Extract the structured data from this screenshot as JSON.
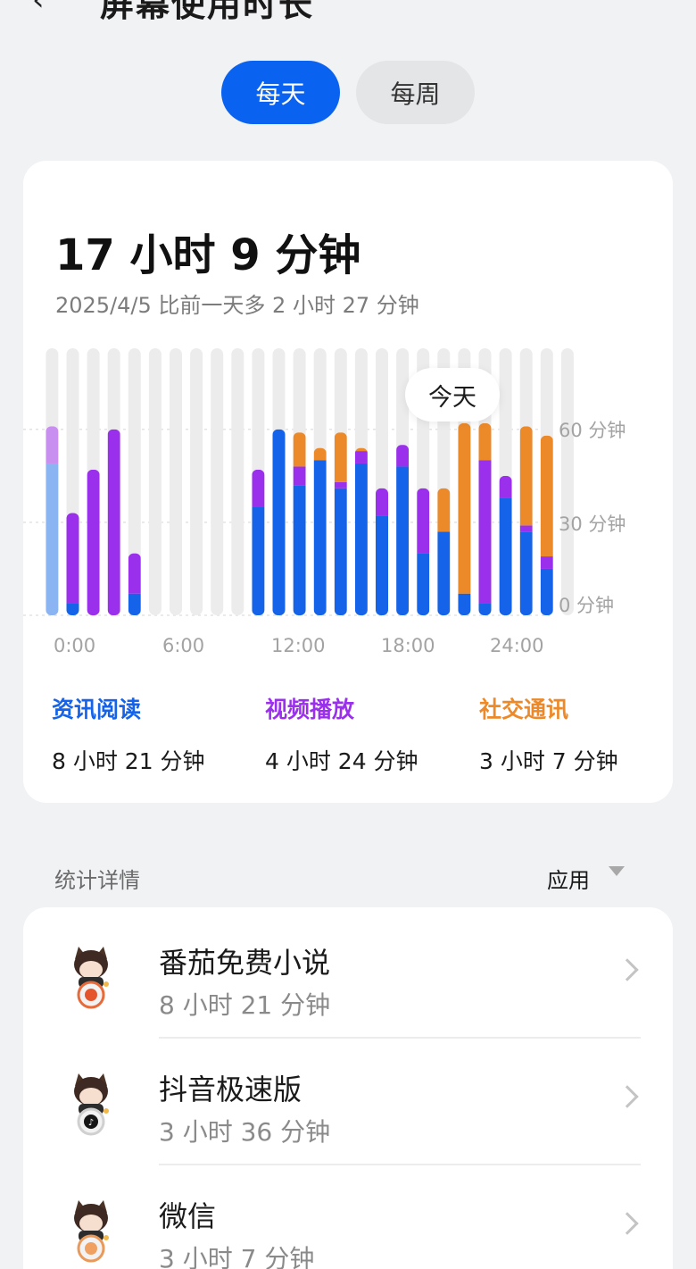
{
  "header": {
    "title": "屏幕使用时长",
    "back_icon": "back-arrow-icon"
  },
  "segments": {
    "day": "每天",
    "week": "每周",
    "selected": "day"
  },
  "summary": {
    "total": "17 小时 9 分钟",
    "compare": "2025/4/5 比前一天多 2 小时 27 分钟",
    "tooltip": "今天"
  },
  "colors": {
    "news": "#1463e8",
    "news_light": "#8ab4f2",
    "video": "#9b30ec",
    "video_light": "#c98ff0",
    "social": "#ec8a2a",
    "track": "#ececec",
    "accent": "#0a62f0"
  },
  "chart_data": {
    "type": "bar",
    "stacked": true,
    "y_tick_labels": [
      "60 分钟",
      "30 分钟",
      "0 分钟"
    ],
    "y_ticks": [
      60,
      30,
      0
    ],
    "ylim": [
      0,
      60
    ],
    "x_tick_labels": [
      "0:00",
      "6:00",
      "12:00",
      "18:00",
      "24:00"
    ],
    "x_ticks": [
      0,
      6,
      12,
      18,
      24
    ],
    "bar_start_hours": [
      -1,
      0,
      1,
      2,
      3,
      4,
      5,
      6,
      7,
      8,
      9,
      10,
      11,
      12,
      13,
      14,
      15,
      16,
      17,
      18,
      19,
      20,
      21,
      22,
      23,
      24
    ],
    "series": [
      {
        "name": "资讯阅读",
        "color": "#1463e8",
        "values": [
          49,
          4,
          0,
          0,
          7,
          0,
          0,
          0,
          0,
          0,
          35,
          60,
          42,
          50,
          41,
          49,
          32,
          48,
          20,
          27,
          7,
          4,
          38,
          27,
          15,
          0
        ]
      },
      {
        "name": "视频播放",
        "color": "#9b30ec",
        "values": [
          12,
          29,
          47,
          60,
          13,
          0,
          0,
          0,
          0,
          0,
          12,
          0,
          6,
          0,
          2,
          4,
          9,
          7,
          21,
          0,
          0,
          46,
          7,
          2,
          4,
          0
        ]
      },
      {
        "name": "社交通讯",
        "color": "#ec8a2a",
        "values": [
          0,
          0,
          0,
          0,
          0,
          0,
          0,
          0,
          0,
          0,
          0,
          0,
          11,
          4,
          16,
          1,
          0,
          0,
          0,
          14,
          55,
          12,
          0,
          32,
          39,
          0
        ]
      }
    ],
    "legend": [
      {
        "name": "资讯阅读",
        "value": "8 小时 21 分钟",
        "color": "#1463e8"
      },
      {
        "name": "视频播放",
        "value": "4 小时 24 分钟",
        "color": "#9b30ec"
      },
      {
        "name": "社交通讯",
        "value": "3 小时 7 分钟",
        "color": "#ec8a2a"
      }
    ],
    "highlight_label": "今天"
  },
  "details": {
    "section_title": "统计详情",
    "sort_label": "应用",
    "apps": [
      {
        "name": "番茄免费小说",
        "time": "8 小时 21 分钟",
        "icon": "tomato-novel-icon"
      },
      {
        "name": "抖音极速版",
        "time": "3 小时 36 分钟",
        "icon": "douyin-lite-icon"
      },
      {
        "name": "微信",
        "time": "3 小时 7 分钟",
        "icon": "wechat-icon"
      }
    ]
  }
}
